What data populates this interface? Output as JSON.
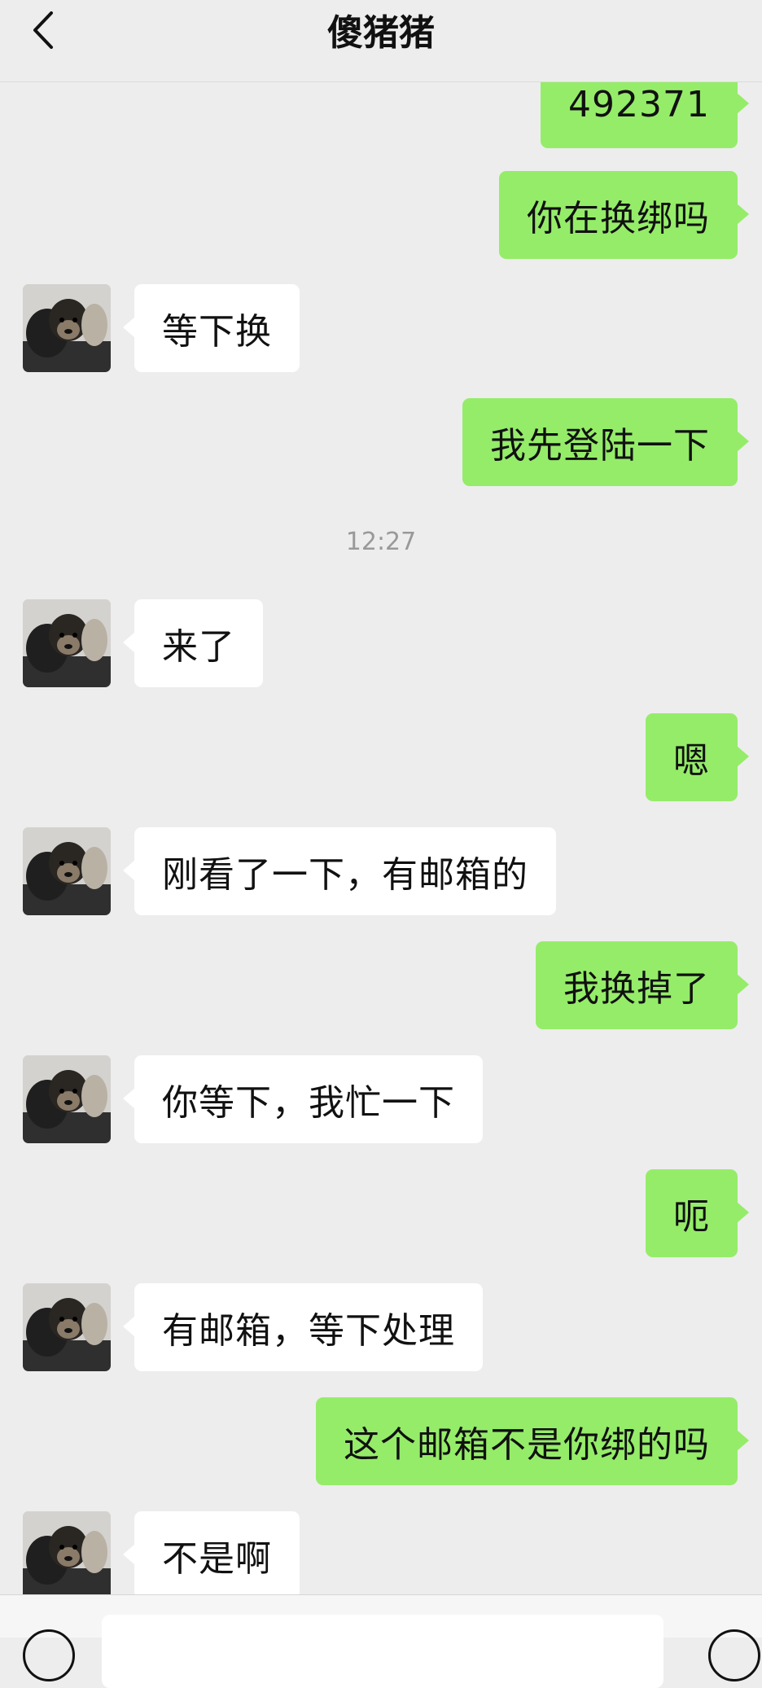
{
  "header": {
    "title": "傻猪猪",
    "back_icon": "chevron-left-icon"
  },
  "timestamp": "12:27",
  "messages": [
    {
      "from": "me",
      "text": "492371"
    },
    {
      "from": "me",
      "text": "你在换绑吗"
    },
    {
      "from": "them",
      "text": "等下换"
    },
    {
      "from": "me",
      "text": "我先登陆一下"
    },
    {
      "from": "them",
      "text": "来了"
    },
    {
      "from": "me",
      "text": "嗯"
    },
    {
      "from": "them",
      "text": "刚看了一下，有邮箱的"
    },
    {
      "from": "me",
      "text": "我换掉了"
    },
    {
      "from": "them",
      "text": "你等下，我忙一下"
    },
    {
      "from": "me",
      "text": "呃"
    },
    {
      "from": "them",
      "text": "有邮箱，等下处理"
    },
    {
      "from": "me",
      "text": "这个邮箱不是你绑的吗"
    },
    {
      "from": "them",
      "text": "不是啊"
    }
  ],
  "colors": {
    "background": "#ededed",
    "my_bubble": "#95ec69",
    "their_bubble": "#ffffff"
  },
  "input_bar": {
    "left_icon": "voice-icon",
    "right_icon": "plus-icon"
  }
}
